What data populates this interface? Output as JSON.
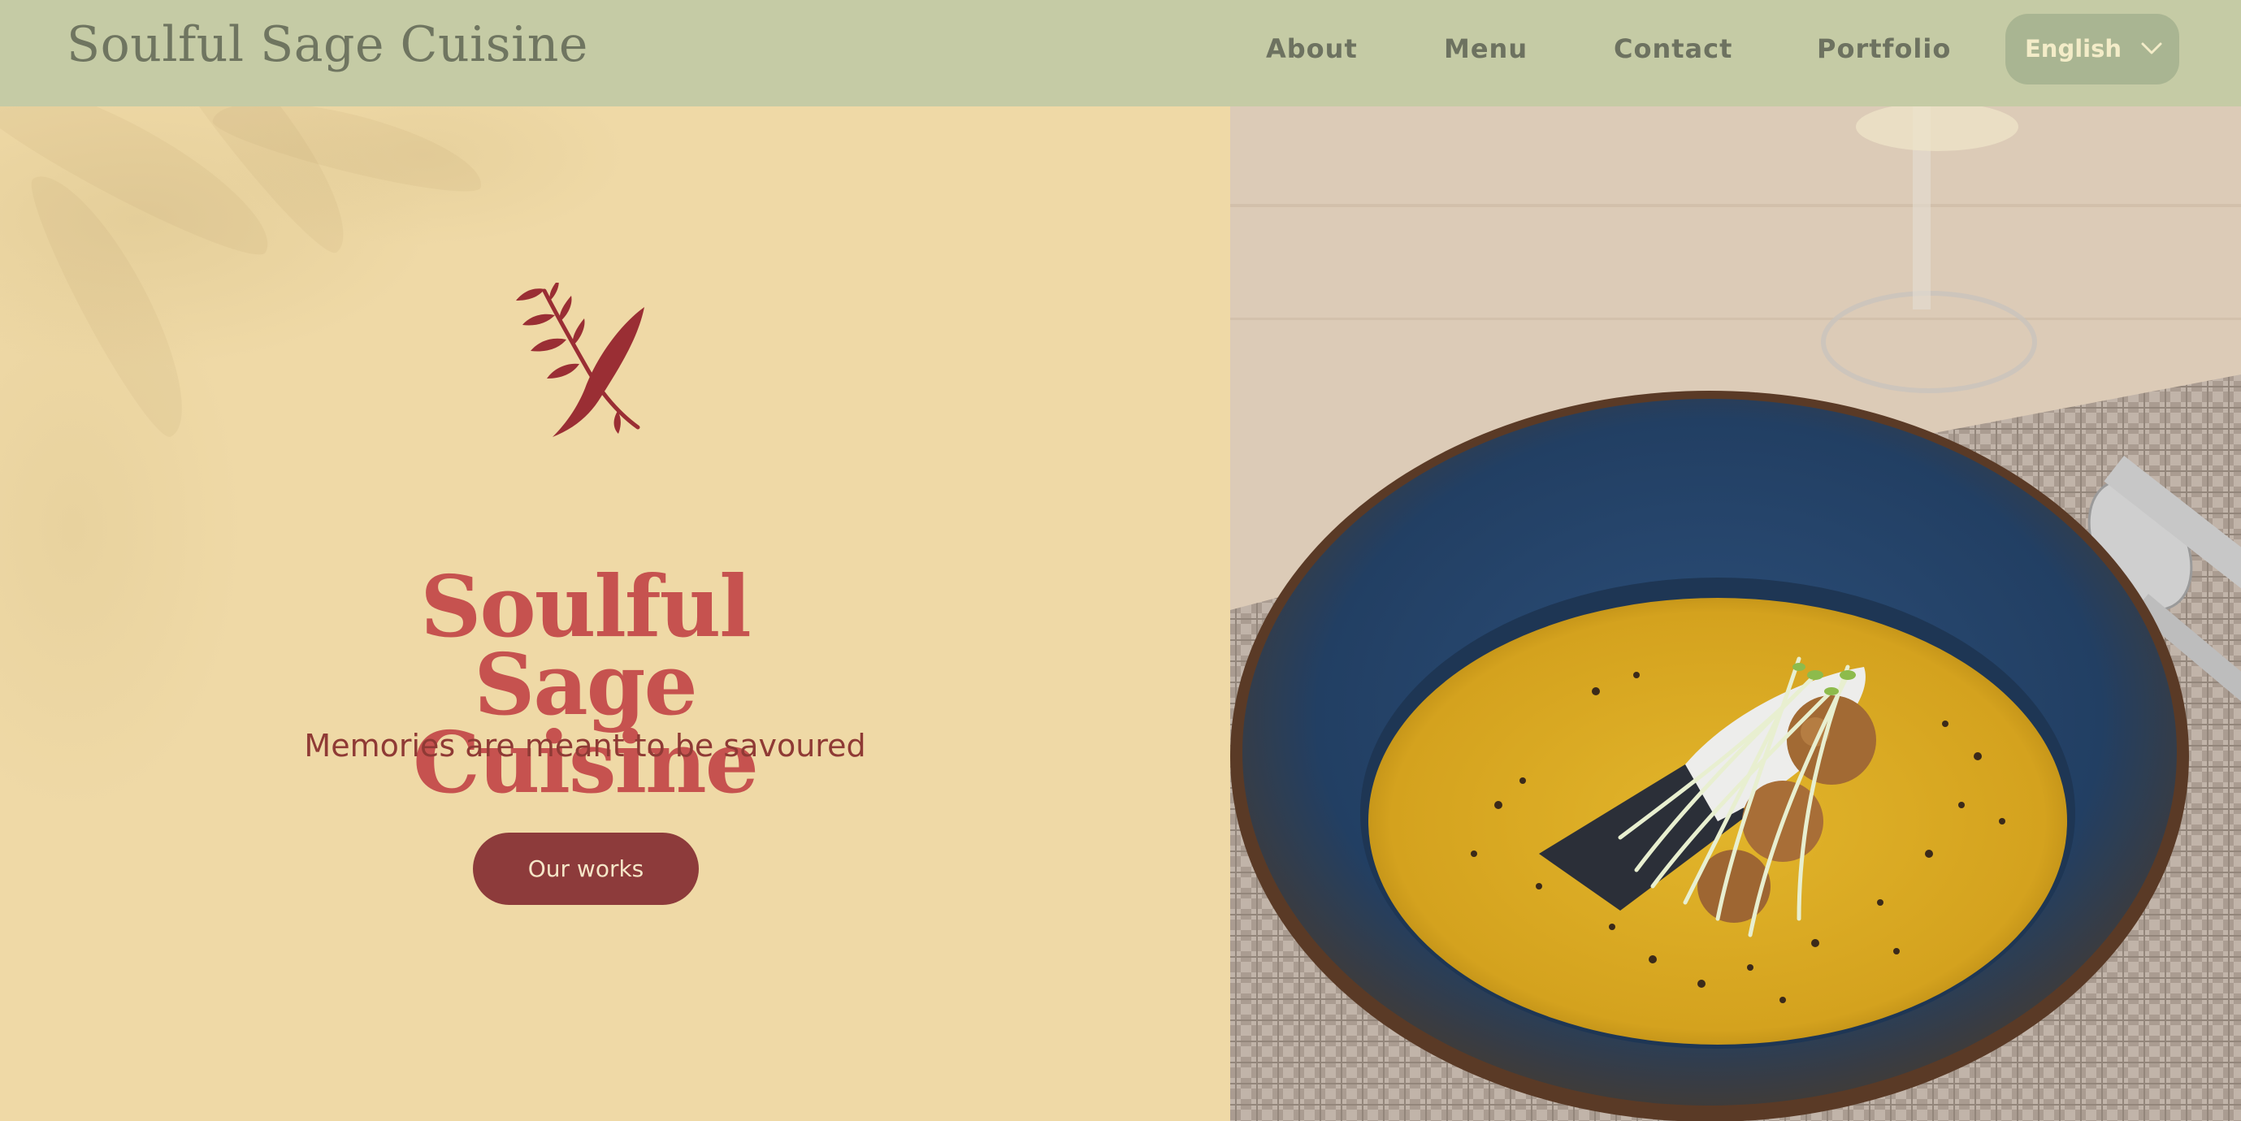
{
  "header": {
    "brand": "Soulful Sage Cuisine",
    "nav": [
      {
        "label": "About"
      },
      {
        "label": "Menu"
      },
      {
        "label": "Contact"
      },
      {
        "label": "Portfolio"
      }
    ],
    "language": {
      "selected": "English",
      "icon": "chevron-down-icon"
    }
  },
  "hero": {
    "logo_icon": "sage-leaf-icon",
    "title_lines": [
      "Soulful",
      "Sage",
      "Cuisine"
    ],
    "tagline": "Memories are meant to be savoured",
    "cta_label": "Our works"
  },
  "colors": {
    "header_bg": "#c5cba5",
    "panel_bg": "#efd9a6",
    "title": "#c6524f",
    "accent": "#8d3b3b",
    "lang_bg": "#a9b592"
  }
}
